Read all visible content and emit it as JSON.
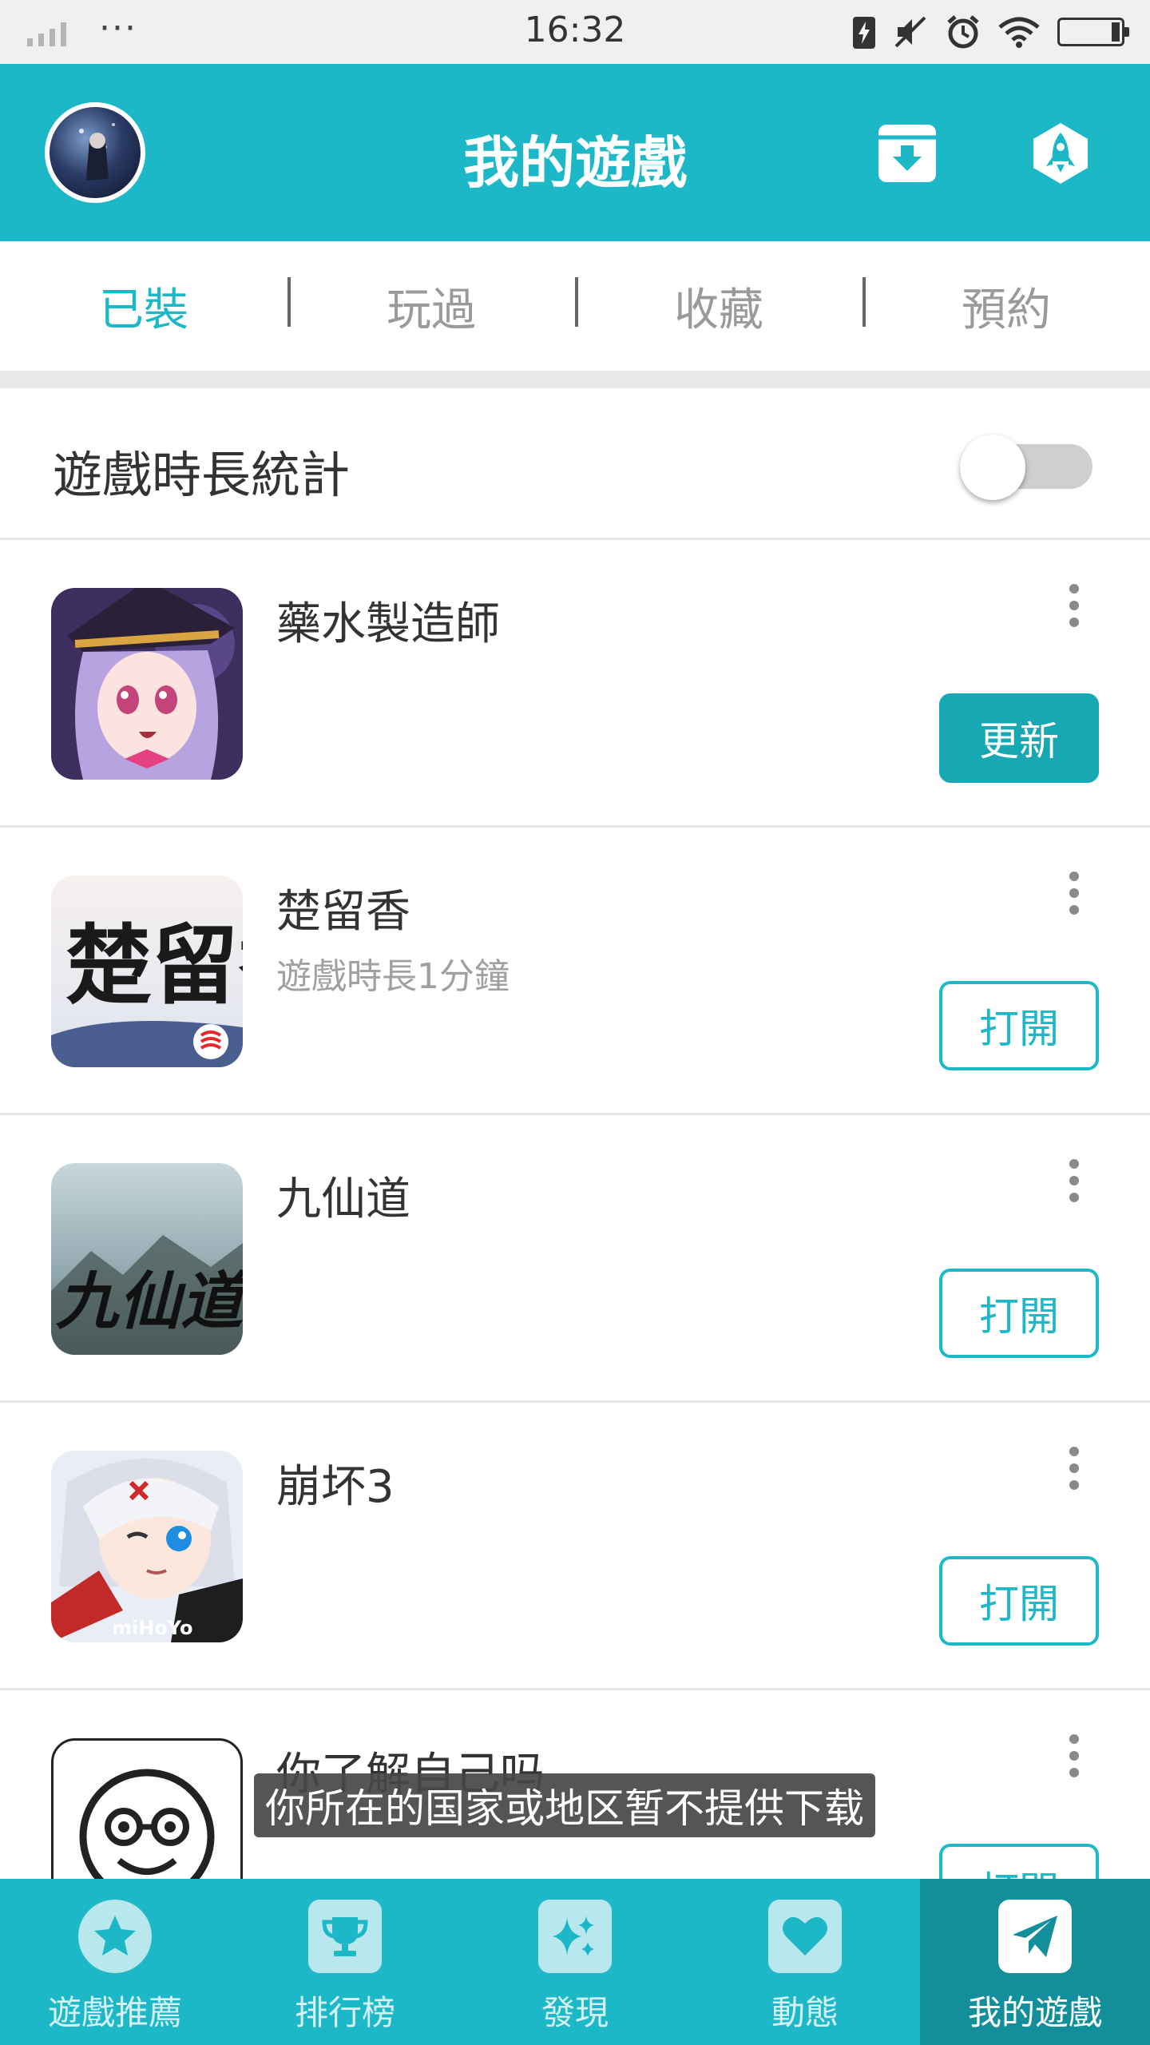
{
  "status_bar": {
    "time": "16:32",
    "more": "···"
  },
  "header": {
    "title": "我的遊戲"
  },
  "tabs": [
    {
      "label": "已裝",
      "active": true
    },
    {
      "label": "玩過",
      "active": false
    },
    {
      "label": "收藏",
      "active": false
    },
    {
      "label": "預約",
      "active": false
    }
  ],
  "stats": {
    "label": "遊戲時長統計",
    "toggle_on": false
  },
  "games": [
    {
      "name": "藥水製造師",
      "subtitle": "",
      "action": "更新",
      "icon": "potion-maker-icon"
    },
    {
      "name": "楚留香",
      "subtitle": "遊戲時長1分鐘",
      "action": "打開",
      "icon": "chu-liu-xiang-icon",
      "icon_text": "楚留香"
    },
    {
      "name": "九仙道",
      "subtitle": "",
      "action": "打開",
      "icon": "jiu-xian-dao-icon",
      "icon_text": "九仙道"
    },
    {
      "name": "崩坏3",
      "subtitle": "",
      "action": "打開",
      "icon": "honkai3-icon",
      "icon_text": "miHoYo"
    },
    {
      "name": "你了解自己吗",
      "subtitle": "",
      "action": "打開",
      "icon": "smiley-glasses-icon"
    }
  ],
  "toast": "你所在的国家或地区暂不提供下载",
  "bottom_nav": [
    {
      "label": "遊戲推薦",
      "icon": "star-icon",
      "active": false
    },
    {
      "label": "排行榜",
      "icon": "trophy-icon",
      "active": false
    },
    {
      "label": "發現",
      "icon": "sparkle-icon",
      "active": false
    },
    {
      "label": "動態",
      "icon": "heart-icon",
      "active": false
    },
    {
      "label": "我的遊戲",
      "icon": "paper-plane-icon",
      "active": true
    }
  ],
  "colors": {
    "brand": "#1db8c7",
    "brand_dark": "#138f9b",
    "update_button": "#17a8b4"
  }
}
